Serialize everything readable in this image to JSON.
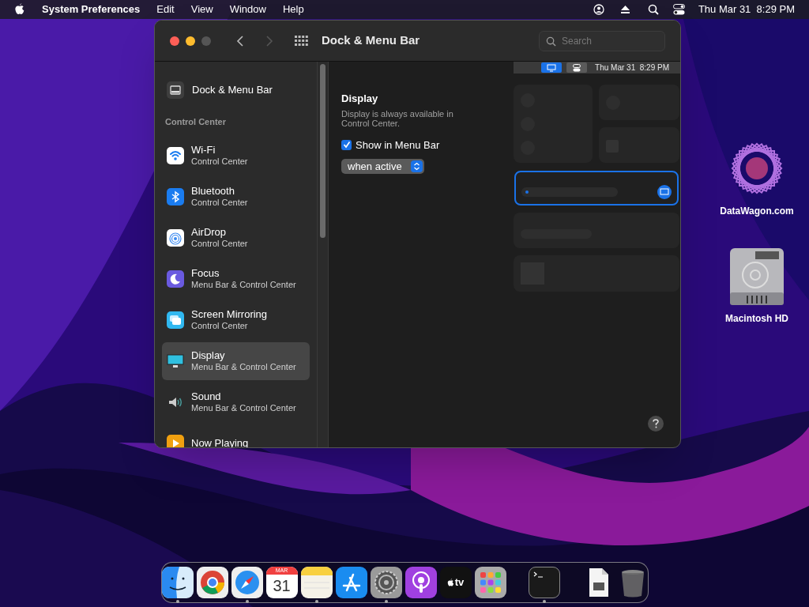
{
  "menubar": {
    "app_name": "System Preferences",
    "menus": [
      "Edit",
      "View",
      "Window",
      "Help"
    ],
    "clock": "Thu Mar 31  8:29 PM"
  },
  "window": {
    "title": "Dock & Menu Bar",
    "search": {
      "placeholder": "Search"
    },
    "sidebar": {
      "top_item": {
        "label": "Dock & Menu Bar",
        "selected": false
      },
      "section_header": "Control Center",
      "items": [
        {
          "label": "Wi-Fi",
          "sublabel": "Control Center",
          "selected": false
        },
        {
          "label": "Bluetooth",
          "sublabel": "Control Center",
          "selected": false
        },
        {
          "label": "AirDrop",
          "sublabel": "Control Center",
          "selected": false
        },
        {
          "label": "Focus",
          "sublabel": "Menu Bar & Control Center",
          "selected": false
        },
        {
          "label": "Screen Mirroring",
          "sublabel": "Control Center",
          "selected": false
        },
        {
          "label": "Display",
          "sublabel": "Menu Bar & Control Center",
          "selected": true
        },
        {
          "label": "Sound",
          "sublabel": "Menu Bar & Control Center",
          "selected": false
        },
        {
          "label": "Now Playing",
          "selected": false
        }
      ]
    },
    "content": {
      "heading": "Display",
      "description": "Display is always available in Control Center.",
      "checkbox": {
        "label": "Show in Menu Bar",
        "checked": true
      },
      "popup": {
        "value": "when active"
      },
      "preview": {
        "clock": "Thu Mar 31  8:29 PM"
      }
    }
  },
  "desktop_icons": [
    {
      "label": "DataWagon.com"
    },
    {
      "label": "Macintosh HD"
    }
  ],
  "dock": {
    "items": [
      {
        "running": true
      },
      {
        "running": false
      },
      {
        "running": true
      },
      {
        "running": false,
        "month": "MAR",
        "day": "31"
      },
      {
        "running": true
      },
      {
        "running": false
      },
      {
        "running": true
      },
      {
        "running": false
      },
      {
        "running": false,
        "text": "tv"
      },
      {
        "running": false
      },
      {
        "running": true
      },
      {
        "running": false
      },
      {
        "running": false
      }
    ]
  }
}
